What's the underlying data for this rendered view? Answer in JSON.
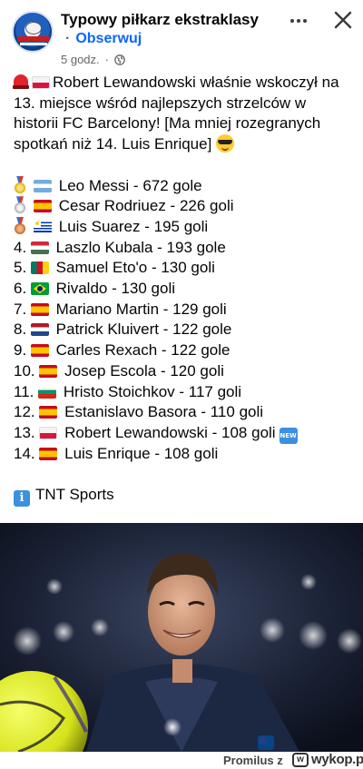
{
  "header": {
    "page_name": "Typowy piłkarz ekstraklasy",
    "follow_separator": "·",
    "follow_label": "Obserwuj",
    "time": "5 godz.",
    "time_separator": "·",
    "more_icon": "more-horizontal-icon",
    "close_icon": "close-icon",
    "privacy_icon": "globe-icon"
  },
  "post": {
    "intro": "Robert Lewandowski właśnie wskoczył na 13. miejsce wśród najlepszych strzelców w historii FC Barcelony! [Ma mniej rozegranych spotkań niż 14. Luis Enrique]",
    "ranking": [
      {
        "rank": "",
        "marker": "gold-medal",
        "flag": "argentina",
        "text": "Leo Messi - 672 gole"
      },
      {
        "rank": "",
        "marker": "silver-medal",
        "flag": "spain",
        "text": "Cesar Rodriuez - 226 goli"
      },
      {
        "rank": "",
        "marker": "bronze-medal",
        "flag": "uruguay",
        "text": "Luis Suarez - 195 goli"
      },
      {
        "rank": "4.",
        "flag": "hungary",
        "text": "Laszlo Kubala - 193 gole"
      },
      {
        "rank": "5.",
        "flag": "cameroon",
        "text": "Samuel Eto'o - 130 goli"
      },
      {
        "rank": "6.",
        "flag": "brazil",
        "text": "Rivaldo - 130 goli"
      },
      {
        "rank": "7.",
        "flag": "spain",
        "text": "Mariano Martin - 129 goli"
      },
      {
        "rank": "8.",
        "flag": "netherlands",
        "text": "Patrick Kluivert - 122 gole"
      },
      {
        "rank": "9.",
        "flag": "spain",
        "text": "Carles Rexach - 122 gole"
      },
      {
        "rank": "10.",
        "flag": "spain",
        "text": "Josep Escola - 120 goli"
      },
      {
        "rank": "11.",
        "flag": "bulgaria",
        "text": "Hristo Stoichkov - 117 goli"
      },
      {
        "rank": "12.",
        "flag": "spain",
        "text": "Estanislavo Basora - 110 goli"
      },
      {
        "rank": "13.",
        "flag": "poland",
        "text": "Robert Lewandowski - 108 goli",
        "badge": "NEW"
      },
      {
        "rank": "14.",
        "flag": "spain",
        "text": "Luis Enrique - 108 goli"
      }
    ],
    "source": "TNT Sports"
  },
  "footer": {
    "user": "Promilus",
    "sep": "z",
    "site_badge": "w",
    "site": "wykop.pl"
  }
}
